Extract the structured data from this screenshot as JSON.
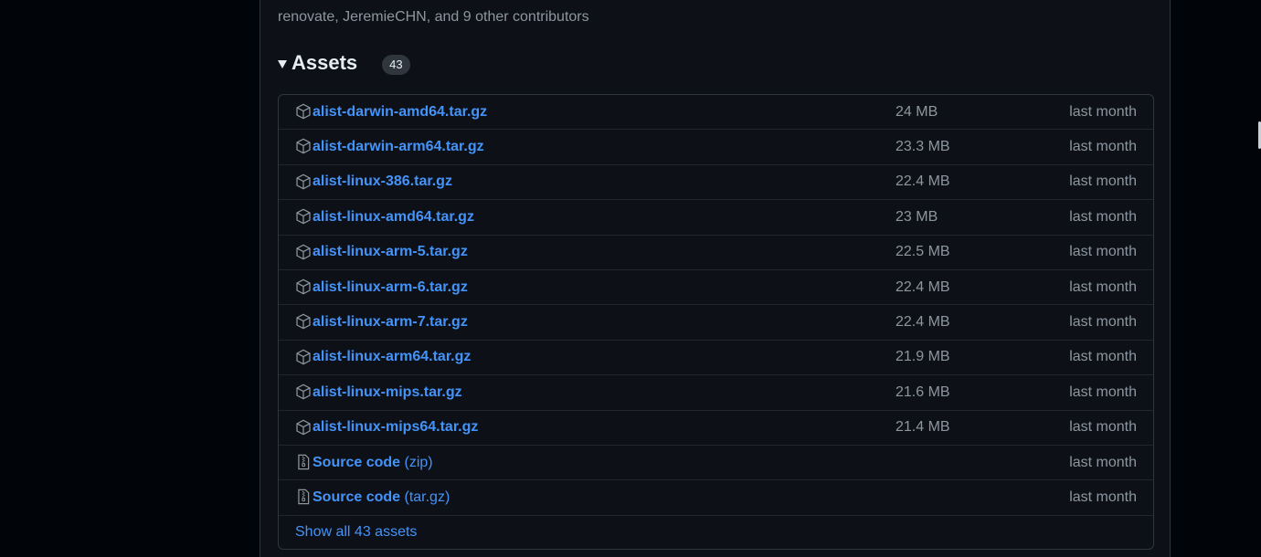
{
  "release": {
    "contributors_text": "renovate, JeremieCHN, and 9 other contributors"
  },
  "assets": {
    "title": "Assets",
    "count": "43",
    "files": [
      {
        "name": "alist-darwin-amd64.tar.gz",
        "size": "24 MB",
        "date": "last month",
        "icon": "package-icon"
      },
      {
        "name": "alist-darwin-arm64.tar.gz",
        "size": "23.3 MB",
        "date": "last month",
        "icon": "package-icon"
      },
      {
        "name": "alist-linux-386.tar.gz",
        "size": "22.4 MB",
        "date": "last month",
        "icon": "package-icon"
      },
      {
        "name": "alist-linux-amd64.tar.gz",
        "size": "23 MB",
        "date": "last month",
        "icon": "package-icon"
      },
      {
        "name": "alist-linux-arm-5.tar.gz",
        "size": "22.5 MB",
        "date": "last month",
        "icon": "package-icon"
      },
      {
        "name": "alist-linux-arm-6.tar.gz",
        "size": "22.4 MB",
        "date": "last month",
        "icon": "package-icon"
      },
      {
        "name": "alist-linux-arm-7.tar.gz",
        "size": "22.4 MB",
        "date": "last month",
        "icon": "package-icon"
      },
      {
        "name": "alist-linux-arm64.tar.gz",
        "size": "21.9 MB",
        "date": "last month",
        "icon": "package-icon"
      },
      {
        "name": "alist-linux-mips.tar.gz",
        "size": "21.6 MB",
        "date": "last month",
        "icon": "package-icon"
      },
      {
        "name": "alist-linux-mips64.tar.gz",
        "size": "21.4 MB",
        "date": "last month",
        "icon": "package-icon"
      }
    ],
    "source": [
      {
        "name": "Source code",
        "suffix": "(zip)",
        "date": "last month",
        "icon": "file-zip-icon"
      },
      {
        "name": "Source code",
        "suffix": "(tar.gz)",
        "date": "last month",
        "icon": "file-zip-icon"
      }
    ],
    "show_all_label": "Show all 43 assets"
  },
  "colors": {
    "background": "#010409",
    "panel": "#0d1117",
    "border": "#30363d",
    "link": "#4493f8",
    "muted": "#8d96a0",
    "text": "#e6edf3"
  }
}
